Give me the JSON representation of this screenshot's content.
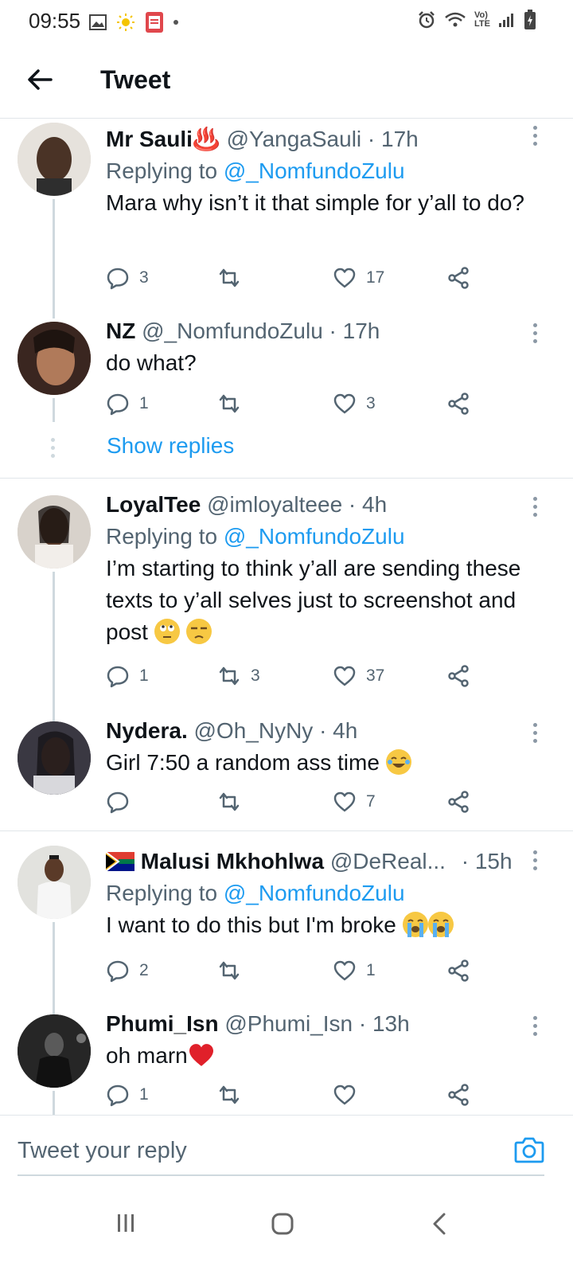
{
  "status_bar": {
    "time": "09:55",
    "indicators": [
      "gallery-icon",
      "sun-icon",
      "pdf-icon",
      "notification-dot"
    ],
    "right_indicators": [
      "alarm-icon",
      "wifi-icon",
      "volte-icon",
      "signal-icon",
      "battery-icon"
    ],
    "volte_top": "Vo)",
    "volte_bottom": "LTE"
  },
  "header": {
    "title": "Tweet"
  },
  "tweets": [
    {
      "name": "Mr Sauli♨️",
      "handle": "@YangaSauli · 17h",
      "replying_prefix": "Replying to",
      "replying_to": "@_NomfundoZulu",
      "text": "Mara why isn’t it that simple for y’all to do?",
      "replies": "3",
      "retweets": "",
      "likes": "17"
    },
    {
      "name": "NZ",
      "handle": "@_NomfundoZulu · 17h",
      "text": "do what?",
      "replies": "1",
      "retweets": "",
      "likes": "3"
    },
    {
      "name": "LoyalTee",
      "handle": "@imloyalteee · 4h",
      "replying_prefix": "Replying to",
      "replying_to": "@_NomfundoZulu",
      "text": "I’m starting to think y’all are sending these texts to y’all selves just to screenshot and post",
      "replies": "1",
      "retweets": "3",
      "likes": "37"
    },
    {
      "name": "Nydera.",
      "handle": "@Oh_NyNy · 4h",
      "text": "Girl 7:50 a random ass time",
      "replies": "",
      "retweets": "",
      "likes": "7"
    },
    {
      "name": "Malusi Mkhohlwa",
      "handle": "@DeReal...",
      "time": "· 15h",
      "replying_prefix": "Replying to",
      "replying_to": "@_NomfundoZulu",
      "text": "I want to do this but I'm broke",
      "replies": "2",
      "retweets": "",
      "likes": "1"
    },
    {
      "name": "Phumi_Isn",
      "handle": "@Phumi_Isn · 13h",
      "text": "oh marn",
      "replies": "1",
      "retweets": "",
      "likes": ""
    }
  ],
  "show_replies": "Show replies",
  "reply_bar": {
    "placeholder": "Tweet your reply"
  },
  "colors": {
    "link": "#1d9bf0",
    "secondary_text": "#536471",
    "divider": "#e1e6ea",
    "thread_line": "#cfd9de"
  }
}
